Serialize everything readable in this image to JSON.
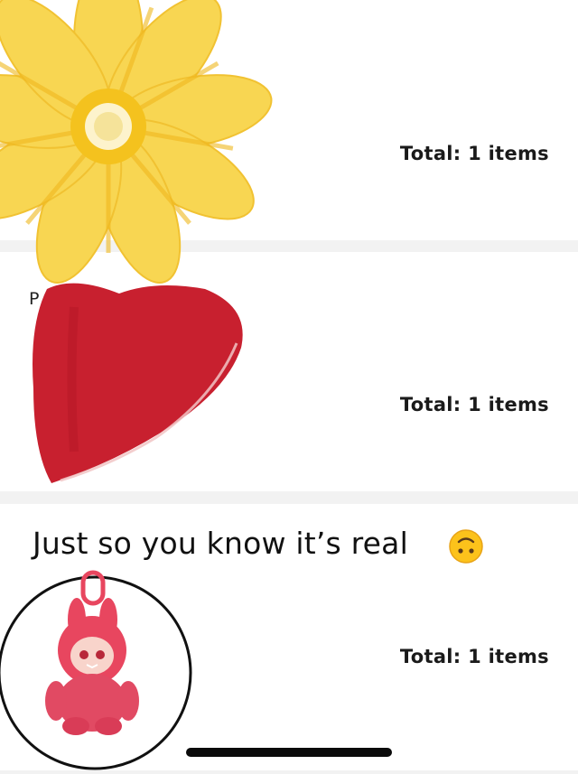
{
  "cards": [
    {
      "total_label": "Total: 1 items"
    },
    {
      "total_label": "Total: 1 items",
      "partial_title": "P"
    },
    {
      "total_label": "Total: 1 items",
      "caption": "Just so you know it’s real",
      "caption_emoji_icon": "upside-down-face-icon",
      "product_image": "pink-bunny-doll-keychain"
    }
  ],
  "decorations": {
    "flower_sticker": "yellow-flower-sticker",
    "heart_sticker": "red-heart-sticker"
  },
  "colors": {
    "background": "#f2f2f2",
    "card": "#ffffff",
    "text": "#1a1a1a",
    "flower": "#f8d652",
    "heart": "#c8202f",
    "doll": "#e8465f"
  }
}
